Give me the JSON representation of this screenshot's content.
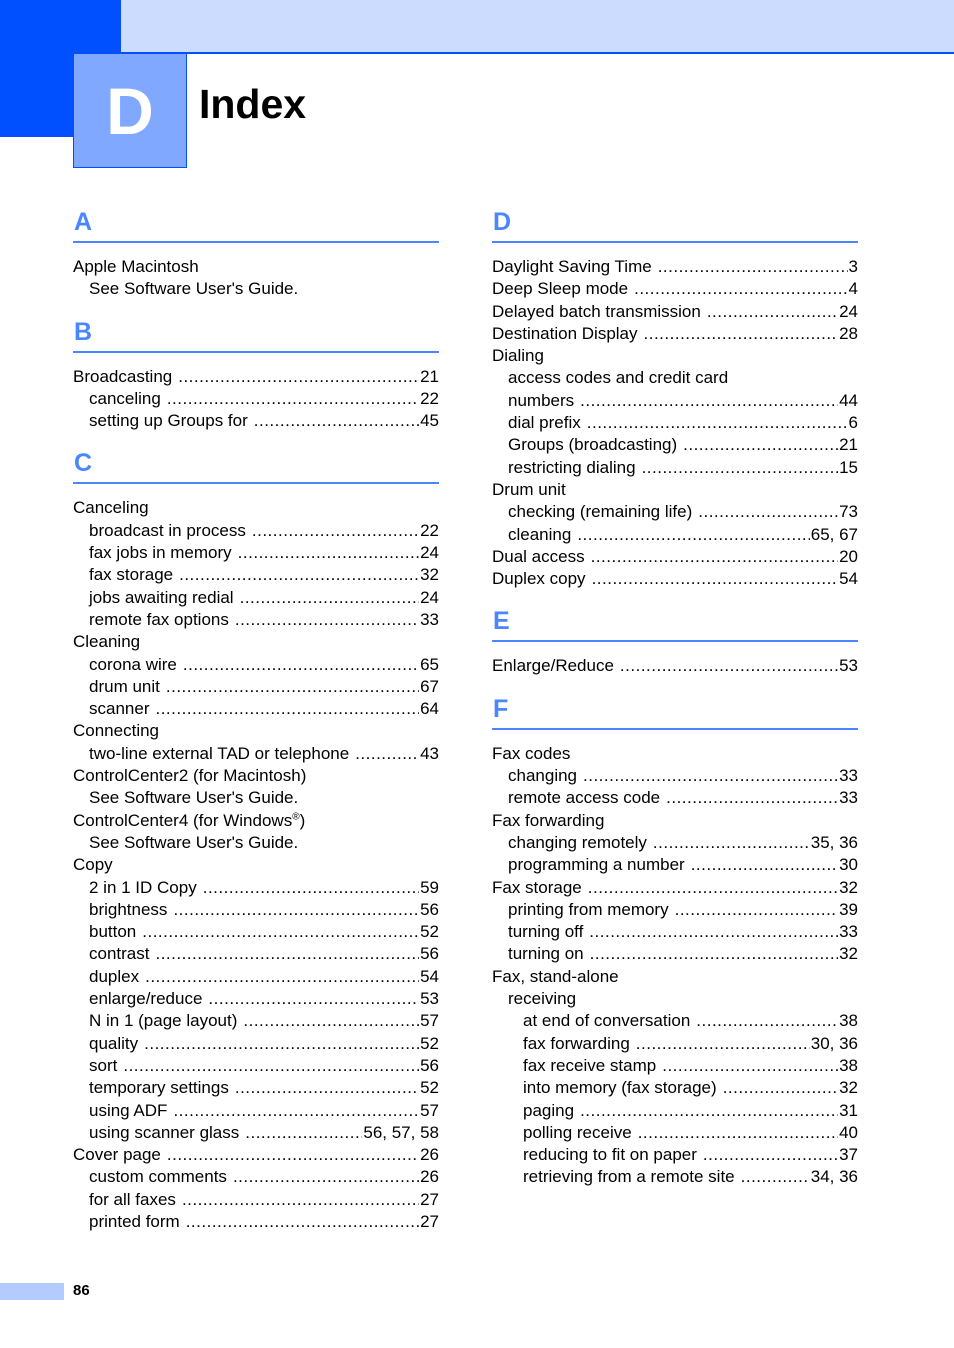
{
  "header": {
    "chapter_letter": "D",
    "title": "Index",
    "colors": {
      "dark_blue": "#0050ff",
      "light_blue": "#ccdcff",
      "chapter_box": "#80a8ff",
      "section_letter": "#4a86ff"
    }
  },
  "columns": [
    {
      "sections": [
        {
          "letter": "A",
          "entries": [
            {
              "level": 0,
              "text": "Apple Macintosh",
              "pages": ""
            },
            {
              "level": 1,
              "text": "See Software User's Guide.",
              "pages": ""
            }
          ]
        },
        {
          "letter": "B",
          "entries": [
            {
              "level": 0,
              "text": "Broadcasting",
              "pages": "21"
            },
            {
              "level": 1,
              "text": "canceling",
              "pages": "22"
            },
            {
              "level": 1,
              "text": "setting up Groups for",
              "pages": "45"
            }
          ]
        },
        {
          "letter": "C",
          "entries": [
            {
              "level": 0,
              "text": "Canceling",
              "pages": ""
            },
            {
              "level": 1,
              "text": "broadcast in process",
              "pages": "22"
            },
            {
              "level": 1,
              "text": "fax jobs in memory",
              "pages": "24"
            },
            {
              "level": 1,
              "text": "fax storage",
              "pages": "32"
            },
            {
              "level": 1,
              "text": "jobs awaiting redial",
              "pages": "24"
            },
            {
              "level": 1,
              "text": "remote fax options",
              "pages": "33"
            },
            {
              "level": 0,
              "text": "Cleaning",
              "pages": ""
            },
            {
              "level": 1,
              "text": "corona wire",
              "pages": "65"
            },
            {
              "level": 1,
              "text": "drum unit",
              "pages": "67"
            },
            {
              "level": 1,
              "text": "scanner",
              "pages": "64"
            },
            {
              "level": 0,
              "text": "Connecting",
              "pages": ""
            },
            {
              "level": 1,
              "text": "two-line external TAD or telephone",
              "pages": "43"
            },
            {
              "level": 0,
              "text": "ControlCenter2 (for Macintosh)",
              "pages": ""
            },
            {
              "level": 1,
              "text": "See Software User's Guide.",
              "pages": ""
            },
            {
              "level": 0,
              "text": "ControlCenter4 (for Windows",
              "sup": "®",
              "suffix": ")",
              "pages": ""
            },
            {
              "level": 1,
              "text": "See Software User's Guide.",
              "pages": ""
            },
            {
              "level": 0,
              "text": "Copy",
              "pages": ""
            },
            {
              "level": 1,
              "text": "2 in 1 ID Copy",
              "pages": "59"
            },
            {
              "level": 1,
              "text": "brightness",
              "pages": "56"
            },
            {
              "level": 1,
              "text": "button",
              "pages": "52"
            },
            {
              "level": 1,
              "text": "contrast",
              "pages": "56"
            },
            {
              "level": 1,
              "text": "duplex",
              "pages": "54"
            },
            {
              "level": 1,
              "text": "enlarge/reduce",
              "pages": "53"
            },
            {
              "level": 1,
              "text": "N in 1 (page layout)",
              "pages": "57"
            },
            {
              "level": 1,
              "text": "quality",
              "pages": "52"
            },
            {
              "level": 1,
              "text": "sort",
              "pages": "56"
            },
            {
              "level": 1,
              "text": "temporary settings",
              "pages": "52"
            },
            {
              "level": 1,
              "text": "using ADF",
              "pages": "57"
            },
            {
              "level": 1,
              "text": "using scanner glass",
              "pages": "56, 57, 58"
            },
            {
              "level": 0,
              "text": "Cover page",
              "pages": "26"
            },
            {
              "level": 1,
              "text": "custom comments",
              "pages": "26"
            },
            {
              "level": 1,
              "text": "for all faxes",
              "pages": "27"
            },
            {
              "level": 1,
              "text": "printed form",
              "pages": "27"
            }
          ]
        }
      ]
    },
    {
      "sections": [
        {
          "letter": "D",
          "entries": [
            {
              "level": 0,
              "text": "Daylight Saving Time",
              "pages": "3"
            },
            {
              "level": 0,
              "text": "Deep Sleep mode",
              "pages": "4"
            },
            {
              "level": 0,
              "text": "Delayed batch transmission",
              "pages": "24"
            },
            {
              "level": 0,
              "text": "Destination Display",
              "pages": "28"
            },
            {
              "level": 0,
              "text": "Dialing",
              "pages": ""
            },
            {
              "level": 1,
              "text": "access codes and credit card",
              "pages": ""
            },
            {
              "level": 1,
              "text": "numbers",
              "pages": "44"
            },
            {
              "level": 1,
              "text": "dial prefix",
              "pages": "6"
            },
            {
              "level": 1,
              "text": "Groups (broadcasting)",
              "pages": "21"
            },
            {
              "level": 1,
              "text": "restricting dialing",
              "pages": "15"
            },
            {
              "level": 0,
              "text": "Drum unit",
              "pages": ""
            },
            {
              "level": 1,
              "text": "checking (remaining life)",
              "pages": "73"
            },
            {
              "level": 1,
              "text": "cleaning",
              "pages": "65, 67"
            },
            {
              "level": 0,
              "text": "Dual access",
              "pages": "20"
            },
            {
              "level": 0,
              "text": "Duplex copy",
              "pages": "54"
            }
          ]
        },
        {
          "letter": "E",
          "entries": [
            {
              "level": 0,
              "text": "Enlarge/Reduce",
              "pages": "53"
            }
          ]
        },
        {
          "letter": "F",
          "entries": [
            {
              "level": 0,
              "text": "Fax codes",
              "pages": ""
            },
            {
              "level": 1,
              "text": "changing",
              "pages": "33"
            },
            {
              "level": 1,
              "text": "remote access code",
              "pages": "33"
            },
            {
              "level": 0,
              "text": "Fax forwarding",
              "pages": ""
            },
            {
              "level": 1,
              "text": "changing remotely",
              "pages": "35, 36"
            },
            {
              "level": 1,
              "text": "programming a number",
              "pages": "30"
            },
            {
              "level": 0,
              "text": "Fax storage",
              "pages": "32"
            },
            {
              "level": 1,
              "text": "printing from memory",
              "pages": "39"
            },
            {
              "level": 1,
              "text": "turning off",
              "pages": "33"
            },
            {
              "level": 1,
              "text": "turning on",
              "pages": "32"
            },
            {
              "level": 0,
              "text": "Fax, stand-alone",
              "pages": ""
            },
            {
              "level": 1,
              "text": "receiving",
              "pages": ""
            },
            {
              "level": 2,
              "text": "at end of conversation",
              "pages": "38"
            },
            {
              "level": 2,
              "text": "fax forwarding",
              "pages": "30, 36"
            },
            {
              "level": 2,
              "text": "fax receive stamp",
              "pages": "38"
            },
            {
              "level": 2,
              "text": "into memory (fax storage)",
              "pages": "32"
            },
            {
              "level": 2,
              "text": "paging",
              "pages": "31"
            },
            {
              "level": 2,
              "text": "polling receive",
              "pages": "40"
            },
            {
              "level": 2,
              "text": "reducing to fit on paper",
              "pages": "37"
            },
            {
              "level": 2,
              "text": "retrieving from a remote site",
              "pages": "34, 36"
            }
          ]
        }
      ]
    }
  ],
  "footer": {
    "page_number": "86"
  }
}
